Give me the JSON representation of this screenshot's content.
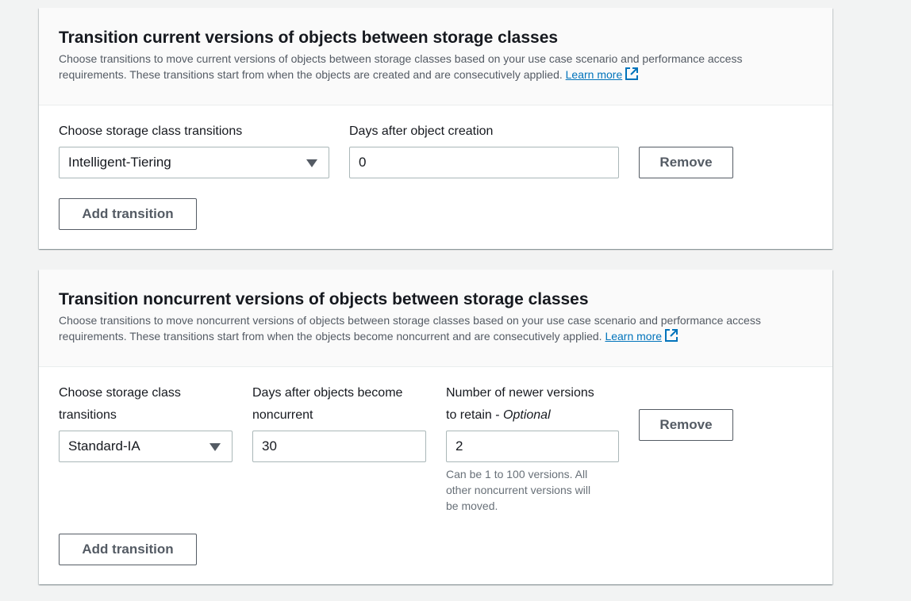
{
  "current_section": {
    "title": "Transition current versions of objects between storage classes",
    "description": "Choose transitions to move current versions of objects between storage classes based on your use case scenario and performance access requirements. These transitions start from when the objects are created and are consecutively applied.",
    "learn_more": "Learn more",
    "storage_class_label": "Choose storage class transitions",
    "storage_class_value": "Intelligent-Tiering",
    "days_label": "Days after object creation",
    "days_value": "0",
    "remove_label": "Remove",
    "add_label": "Add transition"
  },
  "noncurrent_section": {
    "title": "Transition noncurrent versions of objects between storage classes",
    "description": "Choose transitions to move noncurrent versions of objects between storage classes based on your use case scenario and performance access requirements. These transitions start from when the objects become noncurrent and are consecutively applied.",
    "learn_more": "Learn more",
    "storage_class_label_line1": "Choose storage class",
    "storage_class_label_line2": "transitions",
    "storage_class_value": "Standard-IA",
    "days_label_line1": "Days after objects become",
    "days_label_line2": "noncurrent",
    "days_value": "30",
    "versions_label_line1": "Number of newer versions",
    "versions_label_line2": "to retain - ",
    "versions_label_optional": "Optional",
    "versions_value": "2",
    "versions_hint_line1": "Can be 1 to 100 versions. All",
    "versions_hint_line2": "other noncurrent versions will",
    "versions_hint_line3": "be moved.",
    "remove_label": "Remove",
    "add_label": "Add transition"
  },
  "colors": {
    "link": "#0073bb",
    "page_background": "#f2f3f3",
    "header_background": "#fafafa",
    "button_border": "#545b64"
  },
  "icons": [
    "external-link-icon",
    "caret-down-icon"
  ]
}
